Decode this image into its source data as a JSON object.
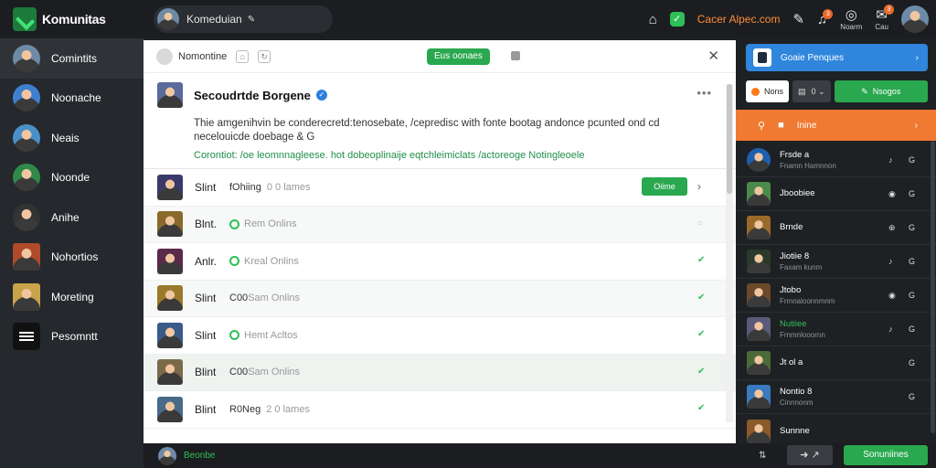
{
  "topbar": {
    "logo_text": "Komunitas",
    "search_text": "Komeduian",
    "brand_link": "Cacer Alpec.com",
    "notif_count_a": "3",
    "notif_count_b": "3",
    "label_a": "Noarm",
    "label_b": "Cau"
  },
  "leftnav": {
    "items": [
      {
        "label": "Comintits",
        "icon": "avatar"
      },
      {
        "label": "Noonache",
        "icon": "avatar"
      },
      {
        "label": "Neais",
        "icon": "avatar"
      },
      {
        "label": "Noonde",
        "icon": "avatar"
      },
      {
        "label": "Anihe",
        "icon": "avatar"
      },
      {
        "label": "Nohortios",
        "icon": "avatar"
      },
      {
        "label": "Moreting",
        "icon": "avatar"
      },
      {
        "label": "Pesomntt",
        "icon": "menu-icon"
      }
    ]
  },
  "panel": {
    "toolbar_title": "Nomontine",
    "pill_label": "Eus oonaes",
    "post": {
      "title": "Secoudrtde Borgene",
      "body": "Thie amgenihvin be conderecretd:tenosebate, /cepredisc with fonte bootag andonce pcunted ond cd necelouicde doebage & G",
      "link": "Corontiot: /oe leomnnagleese. hot dobeoplinaije eqtchleimiclats /actoreoge Notingleoele"
    },
    "rows": [
      {
        "name": "Slint",
        "status": "fOhiing",
        "extra": "0 0 lames",
        "dot": false,
        "button": "Oiime",
        "trail": "chevron"
      },
      {
        "name": "Blnt.",
        "status": "",
        "extra": "Rem Onlins",
        "dot": true,
        "button": "",
        "trail": "circle"
      },
      {
        "name": "Anlr.",
        "status": "",
        "extra": "Kreal Onlins",
        "dot": true,
        "button": "",
        "trail": "check"
      },
      {
        "name": "Slint",
        "status": "C00",
        "extra": "Sam Onlins",
        "dot": false,
        "button": "",
        "trail": "check"
      },
      {
        "name": "Slint",
        "status": "",
        "extra": "Hemt Acltos",
        "dot": true,
        "button": "",
        "trail": "check"
      },
      {
        "name": "Blint",
        "status": "C00",
        "extra": "Sam Onlins",
        "dot": false,
        "button": "",
        "trail": "check"
      },
      {
        "name": "Blint",
        "status": "R0Neg",
        "extra": "2 0 lames",
        "dot": false,
        "button": "",
        "trail": "check"
      }
    ]
  },
  "bottombar": {
    "name": "Beonbe",
    "arrow": "⇅",
    "grey_btn": "➜ ↗",
    "green_btn": "Sonuniines"
  },
  "right": {
    "blue_label": "Goaie Penques",
    "chip1": "Nons",
    "chip2": "0 ⌄",
    "chip3": "Nsogos",
    "orange_label": "Inine",
    "items": [
      {
        "name": "Frsde a",
        "sub": "Fnamn Hamnnon",
        "green": false,
        "a": "♪",
        "b": "G"
      },
      {
        "name": "Jboobiee",
        "sub": "",
        "green": false,
        "a": "◉",
        "b": "G"
      },
      {
        "name": "Brnde",
        "sub": "",
        "green": false,
        "a": "⊕",
        "b": "G"
      },
      {
        "name": "Jiotiie 8",
        "sub": "Faxam kunm",
        "green": false,
        "a": "♪",
        "b": "G"
      },
      {
        "name": "Jtobo",
        "sub": "Frmnaloonnmnm",
        "green": false,
        "a": "◉",
        "b": "G"
      },
      {
        "name": "Nutiiee",
        "sub": "Frnmnlooornn",
        "green": true,
        "a": "♪",
        "b": "G"
      },
      {
        "name": "Jt ol a",
        "sub": "",
        "green": false,
        "a": "",
        "b": "G"
      },
      {
        "name": "Nontio 8",
        "sub": "Cinnnonm",
        "green": false,
        "a": "",
        "b": "G"
      },
      {
        "name": "Sunnne",
        "sub": "",
        "green": false,
        "a": "",
        "b": ""
      }
    ]
  }
}
